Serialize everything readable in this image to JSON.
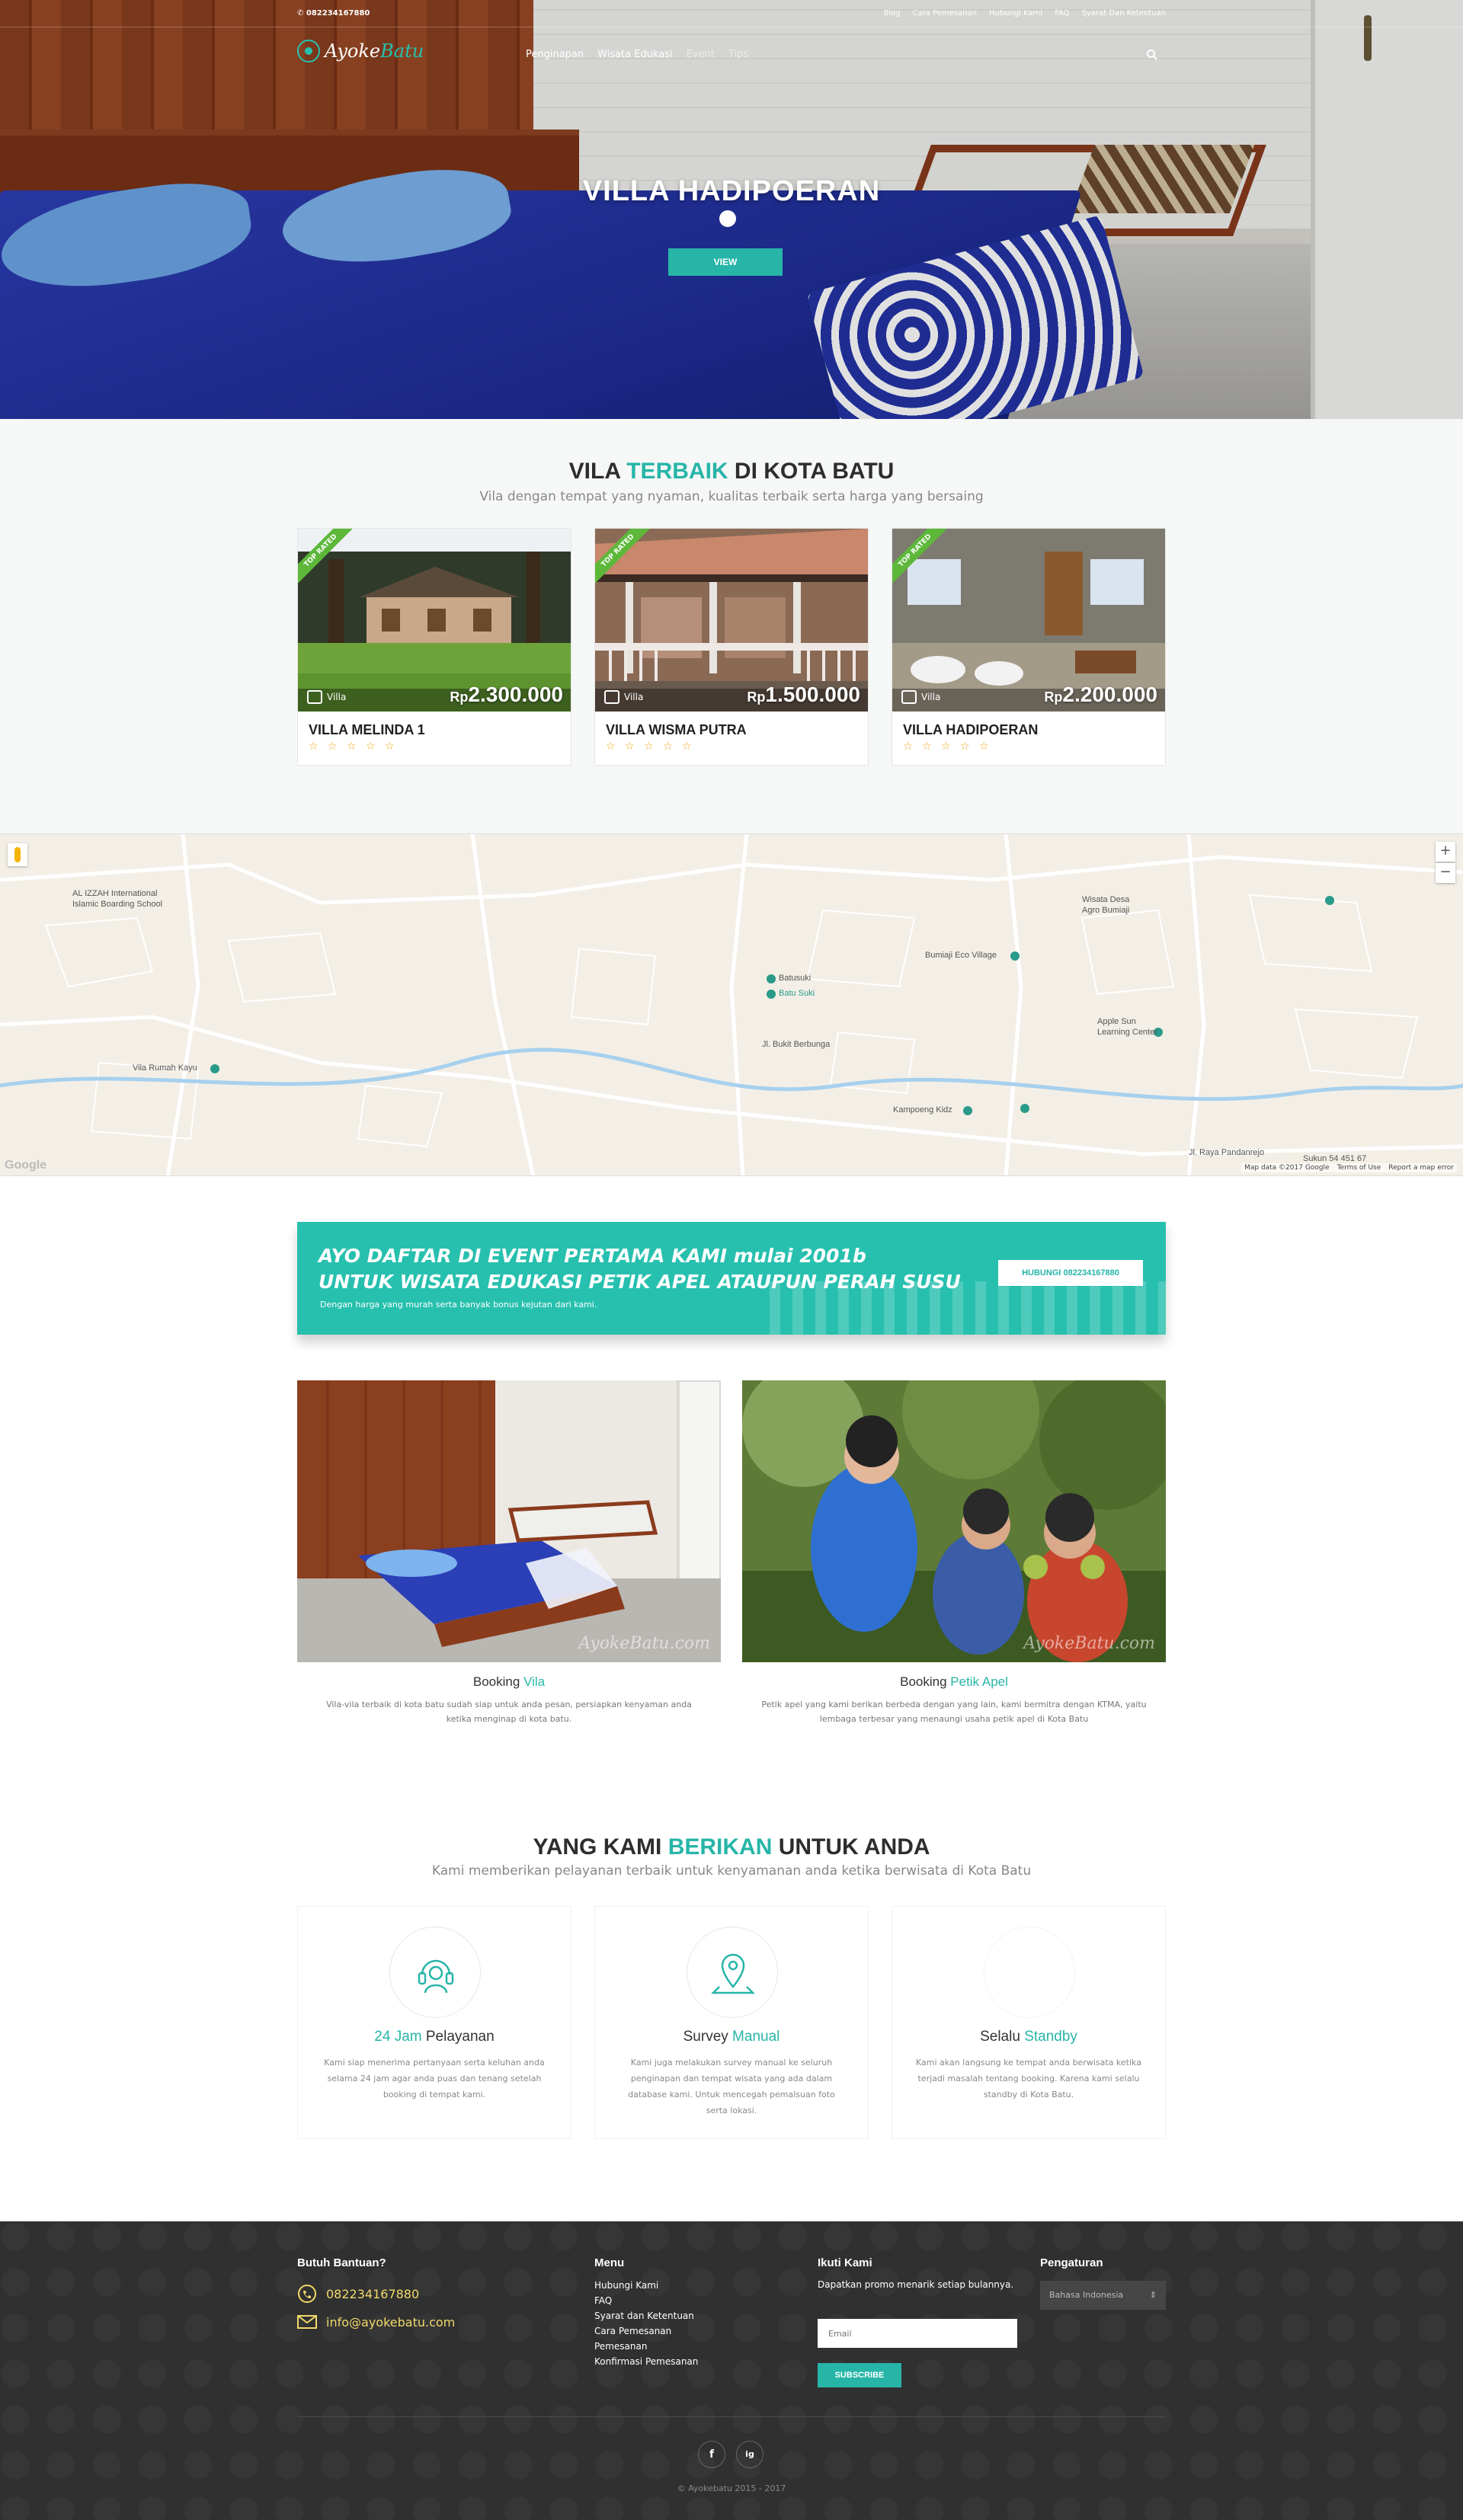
{
  "topbar": {
    "phone": "082234167880",
    "links": [
      "Blog",
      "Cara Pemesanan",
      "Hubungi Kami",
      "FAQ",
      "Syarat Dan Ketentuan"
    ]
  },
  "nav": {
    "logo_left": "Ayoke",
    "logo_right": "Batu",
    "menu": [
      "Penginapan",
      "Wisata Edukasi",
      "Event",
      "Tips"
    ]
  },
  "hero": {
    "title": "VILLA HADIPOERAN",
    "button": "VIEW"
  },
  "villa_section": {
    "title_a": "VILA ",
    "title_hl": "TERBAIK",
    "title_b": " DI KOTA BATU",
    "subtitle": "Vila dengan tempat yang nyaman, kualitas terbaik serta harga yang bersaing",
    "cards": [
      {
        "ribbon": "TOP RATED",
        "type": "Villa",
        "currency": "Rp",
        "price": "2.300.000",
        "name": "VILLA MELINDA 1",
        "stars": "☆ ☆ ☆ ☆ ☆"
      },
      {
        "ribbon": "TOP RATED",
        "type": "Villa",
        "currency": "Rp",
        "price": "1.500.000",
        "name": "VILLA WISMA PUTRA",
        "stars": "☆ ☆ ☆ ☆ ☆"
      },
      {
        "ribbon": "TOP RATED",
        "type": "Villa",
        "currency": "Rp",
        "price": "2.200.000",
        "name": "VILLA HADIPOERAN",
        "stars": "☆ ☆ ☆ ☆ ☆"
      }
    ]
  },
  "map": {
    "labels": [
      "AL IZZAH International",
      "Islamic Boarding School",
      "Batusuki",
      "Batu Suki",
      "Bumiaji Eco Village",
      "Wisata Desa",
      "Agro Bumiaji",
      "Apple Sun",
      "Learning Center",
      "Vila Rumah Kayu",
      "Kampoeng Kidz",
      "Jl. Raya Pandanrejo",
      "Jl. Bukit Berbunga",
      "Sukun 54 451 67"
    ],
    "zoom_in": "+",
    "zoom_out": "−",
    "footer": [
      "Map data ©2017 Google",
      "Terms of Use",
      "Report a map error"
    ],
    "brand": "Google"
  },
  "banner": {
    "line1": "AYO DAFTAR DI EVENT PERTAMA KAMI mulai 2001b",
    "line2": "UNTUK WISATA EDUKASI PETIK APEL ATAUPUN PERAH SUSU",
    "small": "Dengan harga yang murah serta banyak bonus kejutan dari kami.",
    "button": "HUBUNGI 082234167880"
  },
  "booking": [
    {
      "title_a": "Booking ",
      "title_hl": "Vila",
      "desc": "Vila-vila terbaik di kota batu sudah siap untuk anda pesan, persiapkan kenyaman anda ketika menginap di kota batu.",
      "watermark": "AyokeBatu.com"
    },
    {
      "title_a": "Booking ",
      "title_hl": "Petik Apel",
      "desc": "Petik apel yang kami berikan berbeda dengan yang lain, kami bermitra dengan KTMA, yaitu lembaga terbesar yang menaungi usaha petik apel di Kota Batu",
      "watermark": "AyokeBatu.com"
    }
  ],
  "services_section": {
    "title_a": "YANG KAMI ",
    "title_hl": "BERIKAN",
    "title_b": " UNTUK ANDA",
    "subtitle": "Kami memberikan pelayanan terbaik untuk kenyamanan anda ketika berwisata di Kota Batu",
    "items": [
      {
        "title_a": "",
        "title_hl": "24 Jam",
        "title_b": " Pelayanan",
        "desc": "Kami siap menerima pertanyaan serta keluhan anda selama 24 jam agar anda puas dan tenang setelah booking di tempat kami.",
        "icon": "headset-icon"
      },
      {
        "title_a": "Survey ",
        "title_hl": "Manual",
        "title_b": "",
        "desc": "Kami juga melakukan survey manual ke seluruh penginapan dan tempat wisata yang ada dalam database kami. Untuk mencegah pemalsuan foto serta lokasi.",
        "icon": "map-pin-icon"
      },
      {
        "title_a": "Selalu ",
        "title_hl": "Standby",
        "title_b": "",
        "desc": "Kami akan langsung ke tempat anda berwisata ketika terjadi masalah tentang booking. Karena kami selalu standby di Kota Batu.",
        "icon": "standby-icon"
      }
    ]
  },
  "footer": {
    "help_title": "Butuh Bantuan?",
    "phone": "082234167880",
    "email": "info@ayokebatu.com",
    "menu_title": "Menu",
    "menu": [
      "Hubungi Kami",
      "FAQ",
      "Syarat dan Ketentuan",
      "Cara Pemesanan",
      "Pemesanan",
      "Konfirmasi Pemesanan"
    ],
    "follow_title": "Ikuti Kami",
    "follow_text": "Dapatkan promo menarik setiap bulannya.",
    "email_placeholder": "Email",
    "subscribe": "SUBSCRIBE",
    "settings_title": "Pengaturan",
    "language": "Bahasa Indonesia",
    "social": [
      "f",
      "ig"
    ],
    "copyright": "© Ayokebatu 2015 - 2017"
  },
  "colors": {
    "accent": "#27b5a8",
    "footer_bg": "#303030",
    "star": "#f2a516",
    "ribbon": "#5db83a"
  }
}
